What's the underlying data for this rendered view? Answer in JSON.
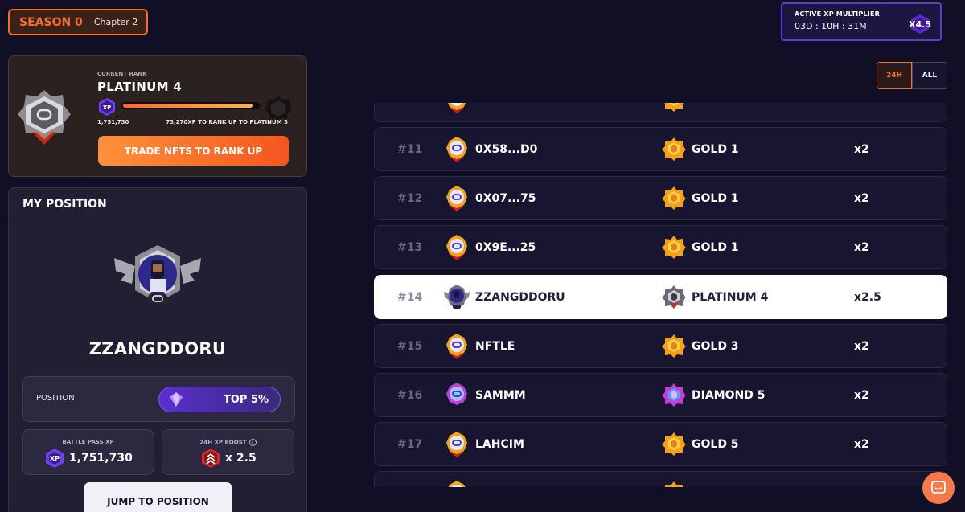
{
  "season": {
    "label": "SEASON 0",
    "chapter": "Chapter 2"
  },
  "multiplier": {
    "title": "ACTIVE XP MULTIPLIER",
    "timer": "03D : 10H : 31M",
    "value": "X4.5"
  },
  "rank": {
    "caption": "CURRENT RANK",
    "name": "PLATINUM 4",
    "xp_badge": "XP",
    "xp": "1,751,730",
    "to_next": "73,270XP TO RANK UP TO PLATINUM 3",
    "progress": 0.96,
    "trade_label": "TRADE NFTS TO RANK UP"
  },
  "my_position": {
    "title": "MY POSITION",
    "username": "ZZANGDDORU",
    "position_label": "POSITION",
    "position_value": "TOP 5%",
    "battle_pass_label": "BATTLE PASS XP",
    "battle_pass_badge": "XP",
    "battle_pass_value": "1,751,730",
    "boost_label": "24H XP BOOST",
    "boost_value": "x 2.5",
    "jump_label": "JUMP TO POSITION"
  },
  "tabs": [
    {
      "label": "24H",
      "active": true
    },
    {
      "label": "ALL",
      "active": false
    }
  ],
  "leaderboard": [
    {
      "num": "#11",
      "name": "0X58...D0",
      "rank": "GOLD 1",
      "mult": "x2",
      "tier": "gold",
      "me": false
    },
    {
      "num": "#12",
      "name": "0X07...75",
      "rank": "GOLD 1",
      "mult": "x2",
      "tier": "gold",
      "me": false
    },
    {
      "num": "#13",
      "name": "0X9E...25",
      "rank": "GOLD 1",
      "mult": "x2",
      "tier": "gold",
      "me": false
    },
    {
      "num": "#14",
      "name": "ZZANGDDORU",
      "rank": "PLATINUM 4",
      "mult": "x2.5",
      "tier": "platinum",
      "me": true
    },
    {
      "num": "#15",
      "name": "NFTLE",
      "rank": "GOLD 3",
      "mult": "x2",
      "tier": "gold",
      "me": false
    },
    {
      "num": "#16",
      "name": "SAMMM",
      "rank": "DIAMOND 5",
      "mult": "x2",
      "tier": "diamond",
      "me": false
    },
    {
      "num": "#17",
      "name": "LAHCIM",
      "rank": "GOLD 5",
      "mult": "x2",
      "tier": "gold",
      "me": false
    }
  ],
  "colors": {
    "accent": "#f26d2e",
    "purple": "#5a3fd6",
    "bg": "#110f26"
  }
}
